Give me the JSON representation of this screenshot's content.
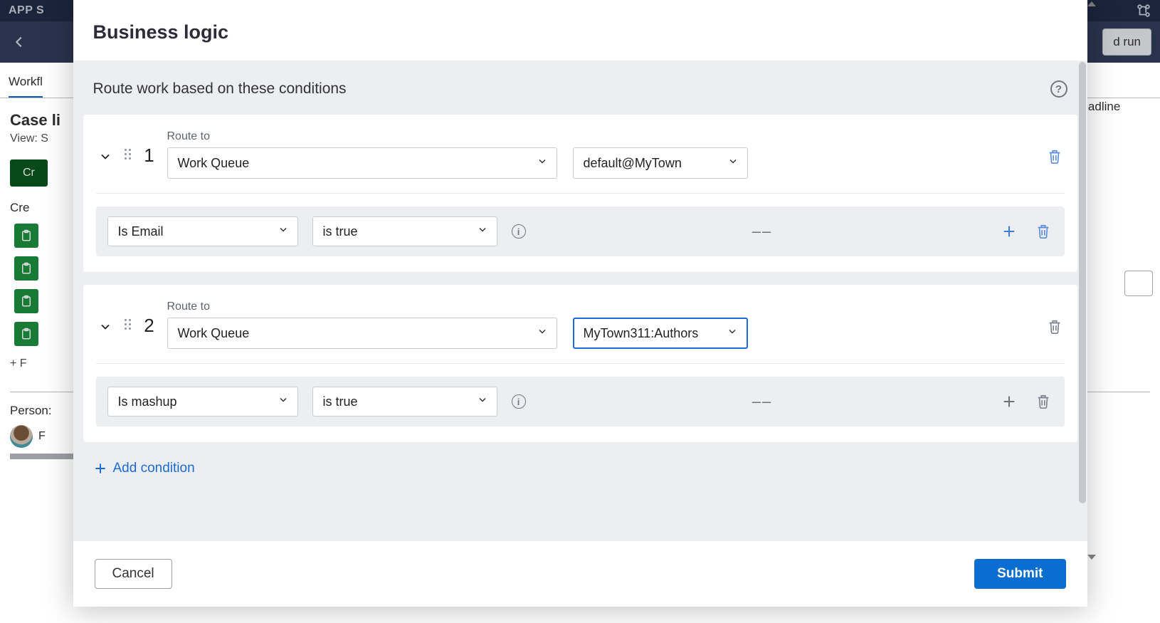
{
  "bg": {
    "app_label": "APP S",
    "run_btn": "d run",
    "tab_workflow": "Workfl",
    "case_title": "Case li",
    "view_line": "View: S",
    "create_btn": "Cr",
    "row_create": "Cre",
    "plus_row": "+ F",
    "persona_title": "Person:",
    "persona_row": "F",
    "right_label": "deadline"
  },
  "modal": {
    "title": "Business logic",
    "section_label": "Route work based on these conditions",
    "routes": [
      {
        "index": "1",
        "route_to_label": "Route to",
        "route_type": "Work Queue",
        "route_target": "default@MyTown",
        "target_focused": false,
        "trash_style": "blue",
        "condition": {
          "field": "Is Email",
          "op": "is true",
          "placeholder": "––",
          "plus_style": "blue",
          "trash_style": "blue"
        }
      },
      {
        "index": "2",
        "route_to_label": "Route to",
        "route_type": "Work Queue",
        "route_target": "MyTown311:Authors",
        "target_focused": true,
        "trash_style": "grey",
        "condition": {
          "field": "Is mashup",
          "op": "is true",
          "placeholder": "––",
          "plus_style": "grey",
          "trash_style": "grey"
        }
      }
    ],
    "add_condition_label": "Add condition",
    "cancel": "Cancel",
    "submit": "Submit"
  }
}
